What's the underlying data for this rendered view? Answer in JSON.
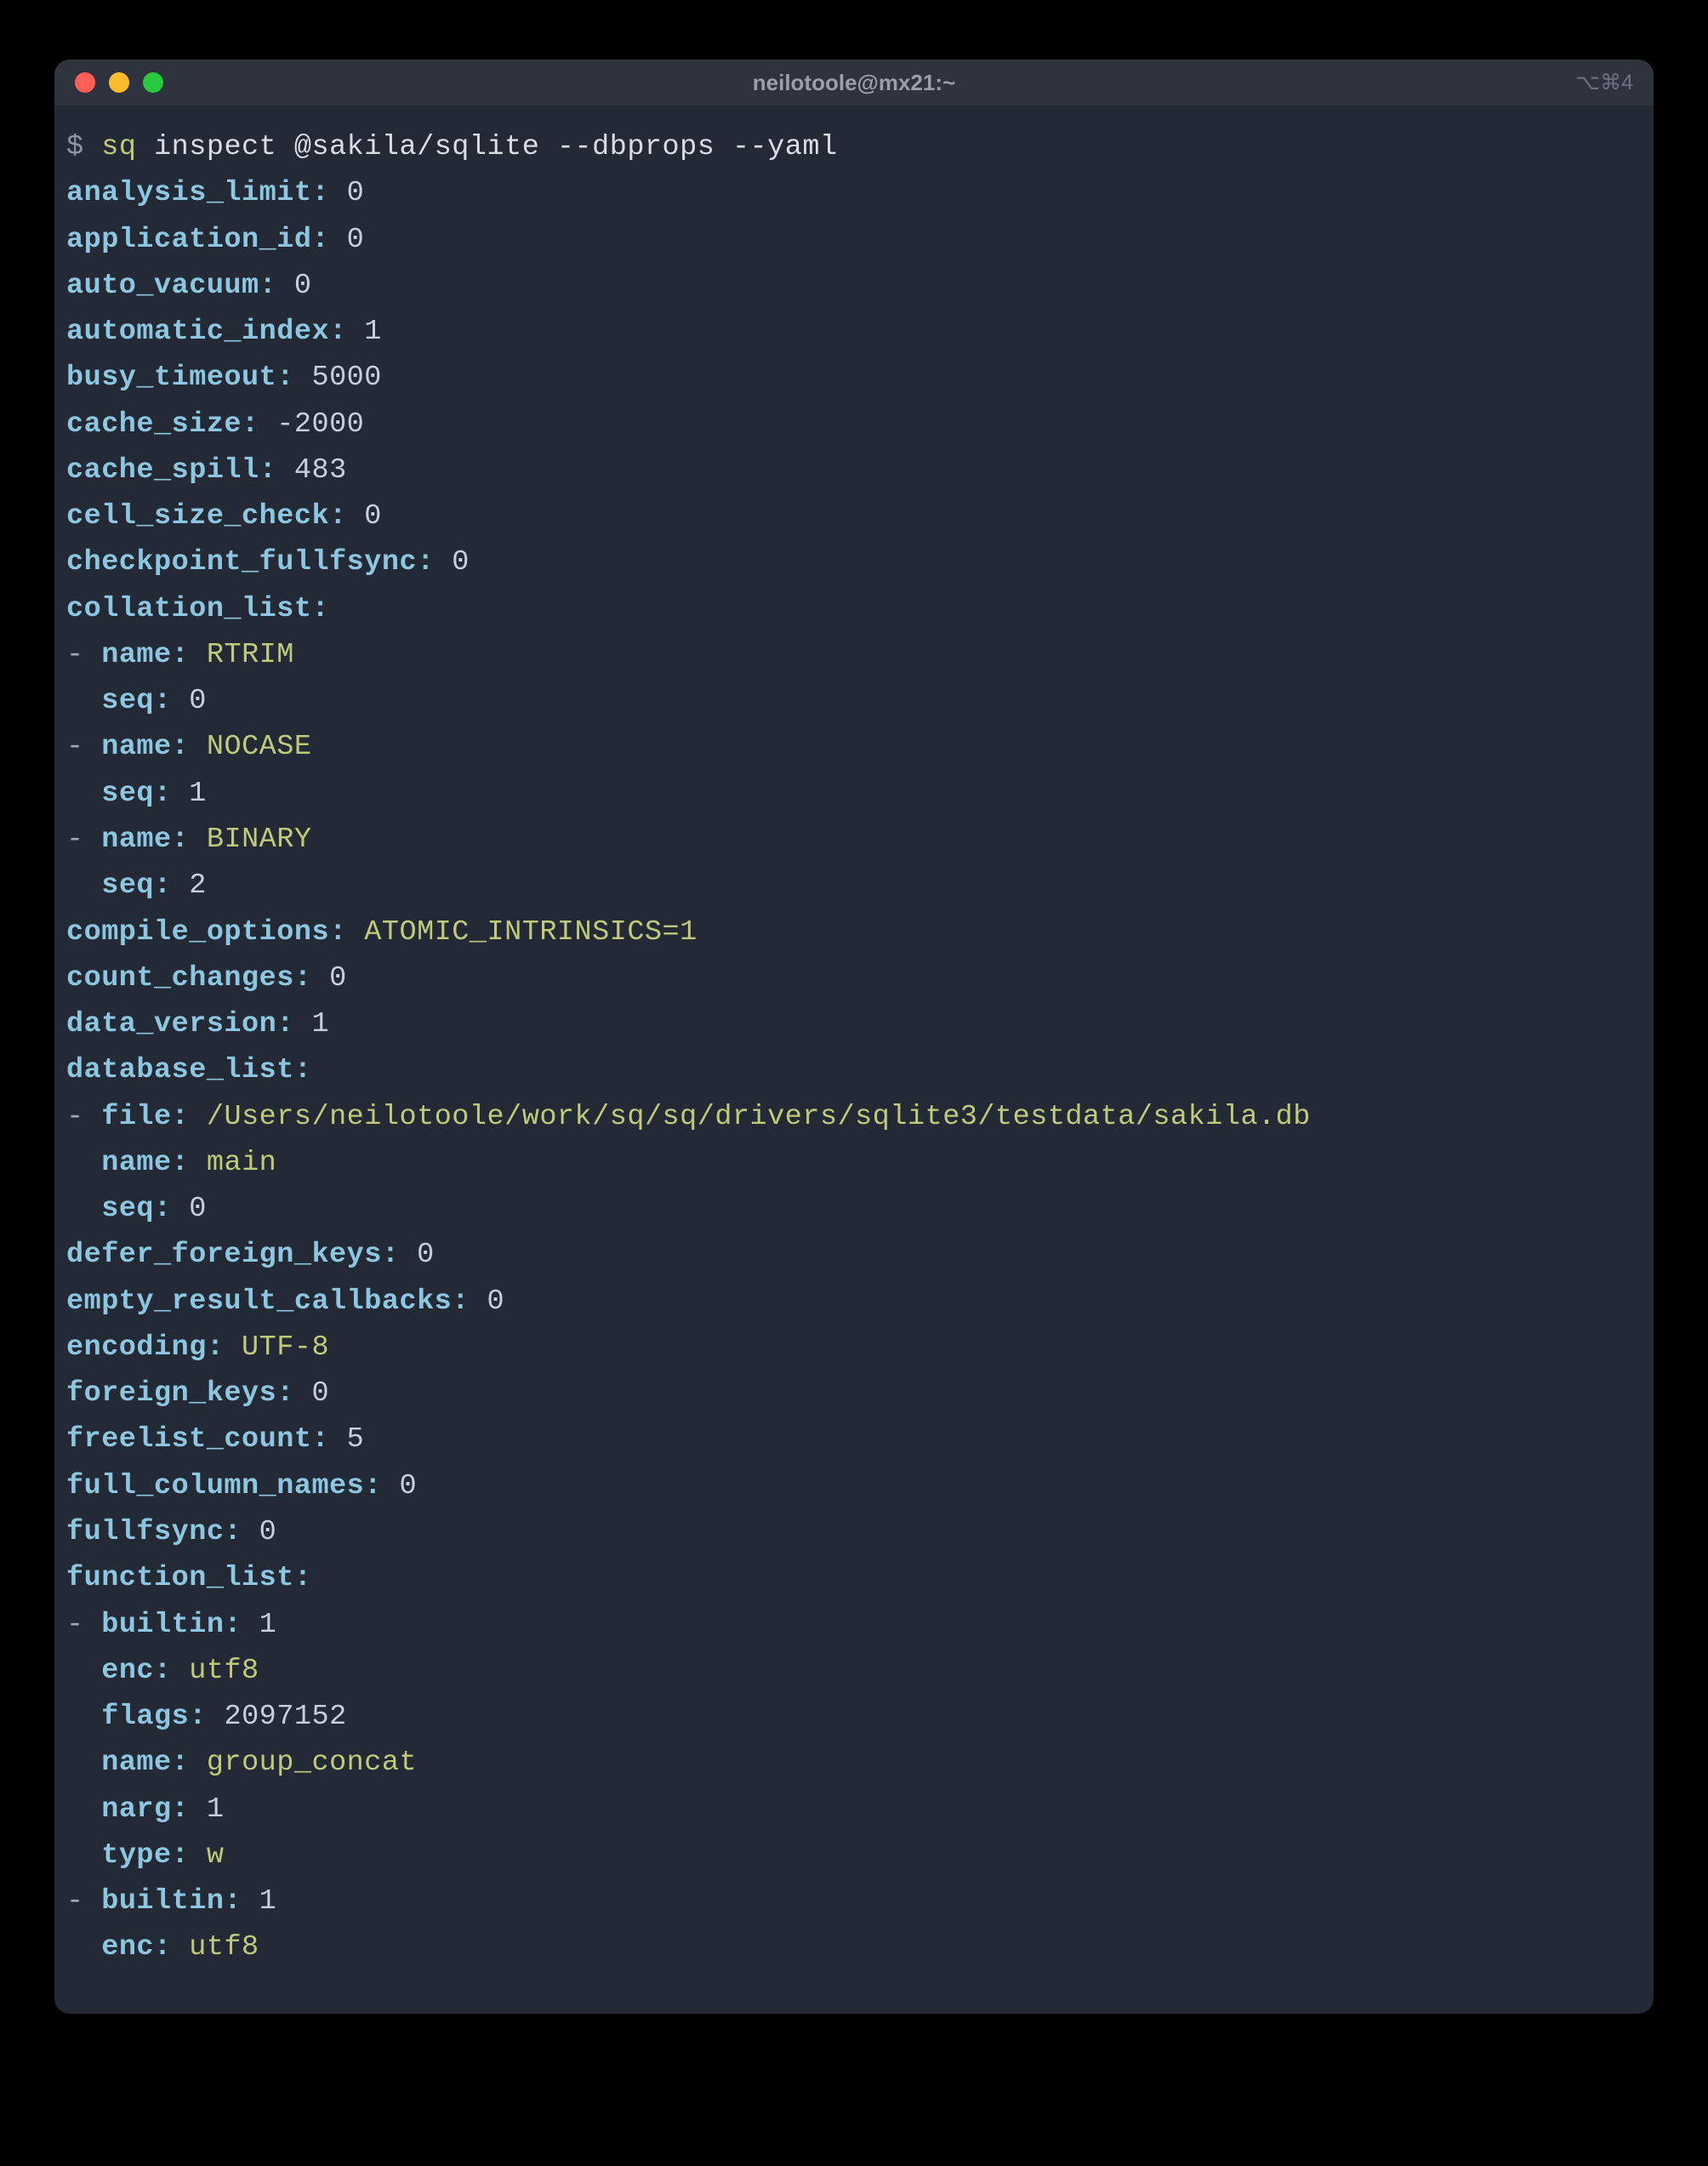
{
  "window": {
    "title": "neilotoole@mx21:~",
    "right_indicator": "⌥⌘4"
  },
  "prompt": "$ ",
  "command": {
    "cmd": "sq",
    "args": " inspect @sakila/sqlite --dbprops --yaml"
  },
  "yaml": {
    "analysis_limit": "0",
    "application_id": "0",
    "auto_vacuum": "0",
    "automatic_index": "1",
    "busy_timeout": "5000",
    "cache_size": "-2000",
    "cache_spill": "483",
    "cell_size_check": "0",
    "checkpoint_fullfsync": "0",
    "collation_list": [
      {
        "name": "RTRIM",
        "seq": "0"
      },
      {
        "name": "NOCASE",
        "seq": "1"
      },
      {
        "name": "BINARY",
        "seq": "2"
      }
    ],
    "compile_options": "ATOMIC_INTRINSICS=1",
    "count_changes": "0",
    "data_version": "1",
    "database_list": [
      {
        "file": "/Users/neilotoole/work/sq/sq/drivers/sqlite3/testdata/sakila.db",
        "name": "main",
        "seq": "0"
      }
    ],
    "defer_foreign_keys": "0",
    "empty_result_callbacks": "0",
    "encoding": "UTF-8",
    "foreign_keys": "0",
    "freelist_count": "5",
    "full_column_names": "0",
    "fullfsync": "0",
    "function_list": [
      {
        "builtin": "1",
        "enc": "utf8",
        "flags": "2097152",
        "name": "group_concat",
        "narg": "1",
        "type": "w"
      },
      {
        "builtin": "1",
        "enc": "utf8"
      }
    ]
  }
}
